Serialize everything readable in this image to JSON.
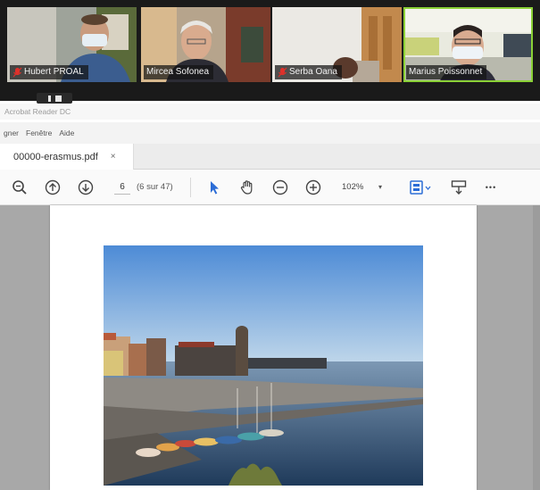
{
  "conference": {
    "participants": [
      {
        "name": "Hubert PROAL",
        "muted": true,
        "active": false
      },
      {
        "name": "Mircea Sofonea",
        "muted": false,
        "active": false
      },
      {
        "name": "Serba Oana",
        "muted": true,
        "active": false
      },
      {
        "name": "Marius Poissonnet",
        "muted": false,
        "active": true
      }
    ]
  },
  "app": {
    "title": "Acrobat Reader DC",
    "menu": [
      "gner",
      "Fenêtre",
      "Aide"
    ]
  },
  "tab": {
    "label": "00000-erasmus.pdf",
    "close": "×"
  },
  "toolbar": {
    "page_current": "6",
    "page_count": "(6 sur 47)",
    "zoom": "102%",
    "zoom_arrow": "▾",
    "more": "•••",
    "icons": [
      "zoom-out-search-icon",
      "page-up-icon",
      "page-down-icon",
      "select-arrow-icon",
      "hand-icon",
      "zoom-minus-icon",
      "zoom-plus-icon",
      "page-display-icon",
      "scroll-mode-icon",
      "more-icon"
    ]
  },
  "colors": {
    "accent_blue": "#2b6cd6",
    "active_speaker": "#8ad136",
    "muted_mic": "#e0312b"
  }
}
